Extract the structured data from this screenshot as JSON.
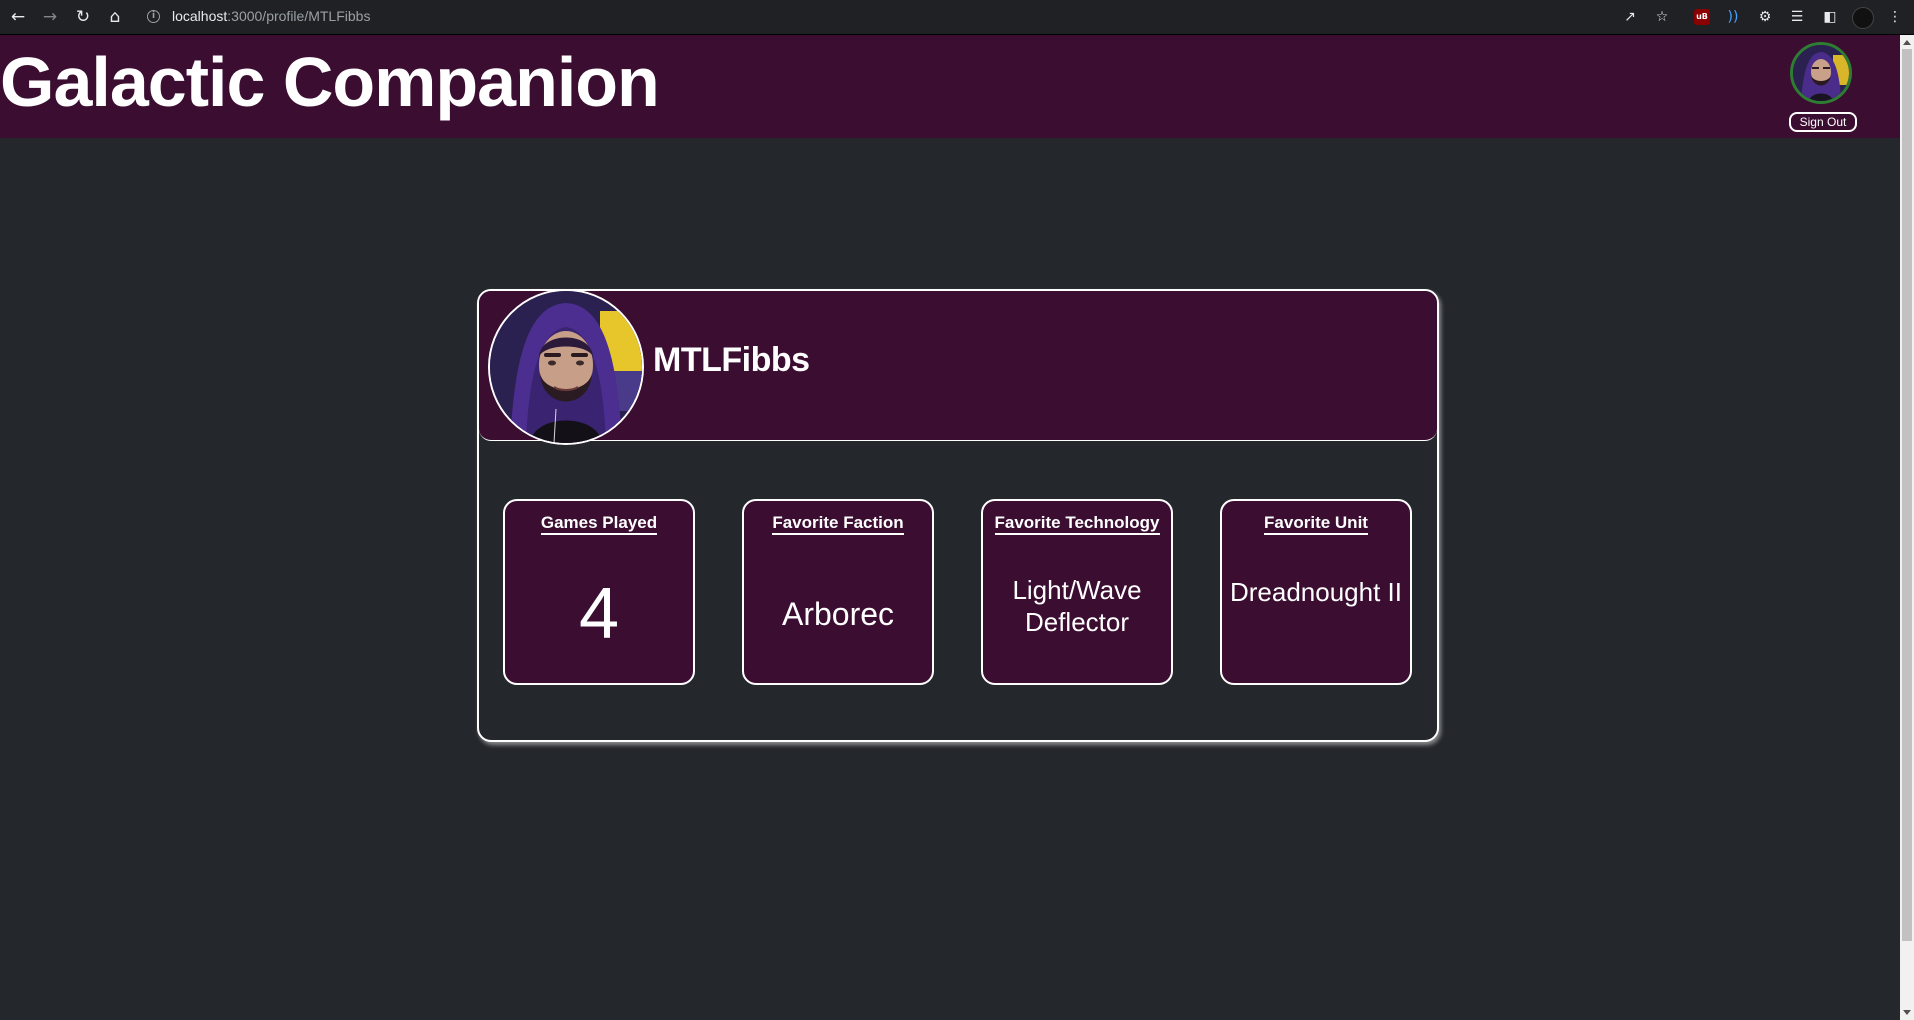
{
  "browser": {
    "url_host": "localhost",
    "url_path": ":3000/profile/MTLFibbs",
    "extension_badge": "uB"
  },
  "header": {
    "title": "Galactic Companion",
    "sign_out_label": "Sign Out"
  },
  "profile": {
    "username": "MTLFibbs",
    "stats": [
      {
        "label": "Games Played",
        "value": "4"
      },
      {
        "label": "Favorite Faction",
        "value": "Arborec"
      },
      {
        "label": "Favorite Technology",
        "value": "Light/Wave Deflector"
      },
      {
        "label": "Favorite Unit",
        "value": "Dreadnought II"
      }
    ]
  },
  "colors": {
    "header_bg": "#3b0d31",
    "page_bg": "#24272c",
    "avatar_ring": "#2e7d32"
  }
}
